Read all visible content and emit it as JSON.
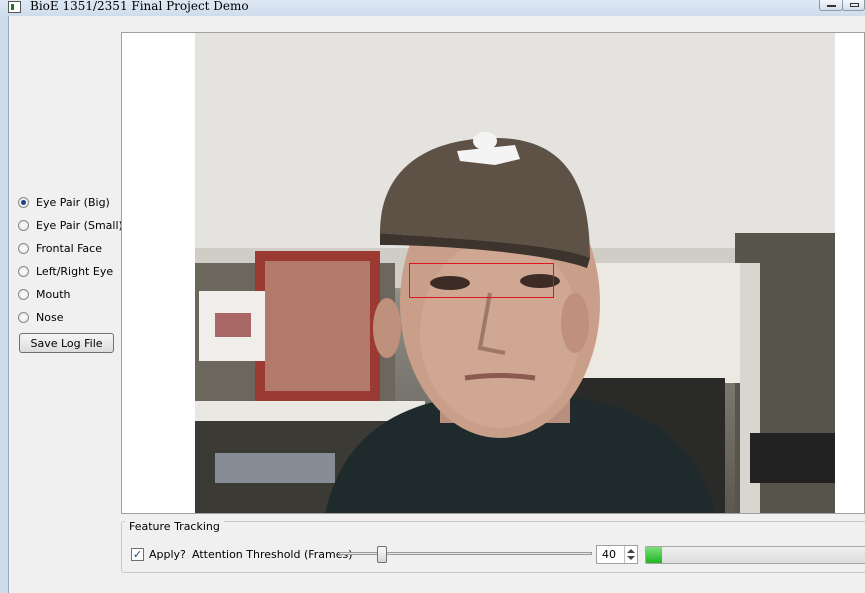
{
  "window": {
    "title": "BioE 1351/2351 Final Project Demo"
  },
  "sidebar": {
    "selected_index": 0,
    "options": [
      {
        "label": "Eye Pair (Big)"
      },
      {
        "label": "Eye Pair (Small)"
      },
      {
        "label": "Frontal Face"
      },
      {
        "label": "Left/Right Eye"
      },
      {
        "label": "Mouth"
      },
      {
        "label": "Nose"
      }
    ],
    "save_button": "Save Log File"
  },
  "feature_tracking": {
    "group_title": "Feature Tracking",
    "apply_checked": true,
    "apply_label": "Apply?",
    "threshold_label": "Attention Threshold (Frames)",
    "threshold_value": "40",
    "slider_fraction": 0.17,
    "progress_fraction": 0.07
  },
  "colors": {
    "detection_box": "#e0141e",
    "progress_fill": "#1fb51f",
    "radio_dot": "#1c3f8a"
  }
}
